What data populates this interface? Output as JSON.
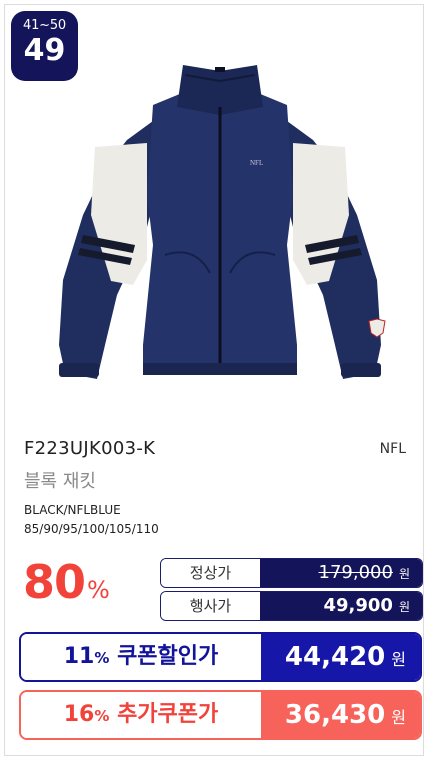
{
  "rank": {
    "range": "41~50",
    "number": "49"
  },
  "product": {
    "model_code": "F223UJK003-K",
    "brand": "NFL",
    "name": "블록 재킷",
    "color": "BLACK/NFLBLUE",
    "sizes": "85/90/95/100/105/110",
    "logo_text": "NFL"
  },
  "discount": {
    "value": "80",
    "unit": "%"
  },
  "prices": {
    "regular": {
      "label": "정상가",
      "amount": "179,000",
      "unit": "원"
    },
    "event": {
      "label": "행사가",
      "amount": "49,900",
      "unit": "원"
    }
  },
  "coupons": [
    {
      "percent": "11",
      "percent_sign": "%",
      "label": "쿠폰할인가",
      "amount": "44,420",
      "unit": "원"
    },
    {
      "percent": "16",
      "percent_sign": "%",
      "label": "추가쿠폰가",
      "amount": "36,430",
      "unit": "원"
    }
  ],
  "colors": {
    "navy": "#14145a",
    "coupon_blue": "#1616a8",
    "accent_red": "#f2433b",
    "coupon_red": "#f7625a",
    "jacket_navy": "#1f2e5e",
    "sleeve_white": "#ecebe6"
  }
}
